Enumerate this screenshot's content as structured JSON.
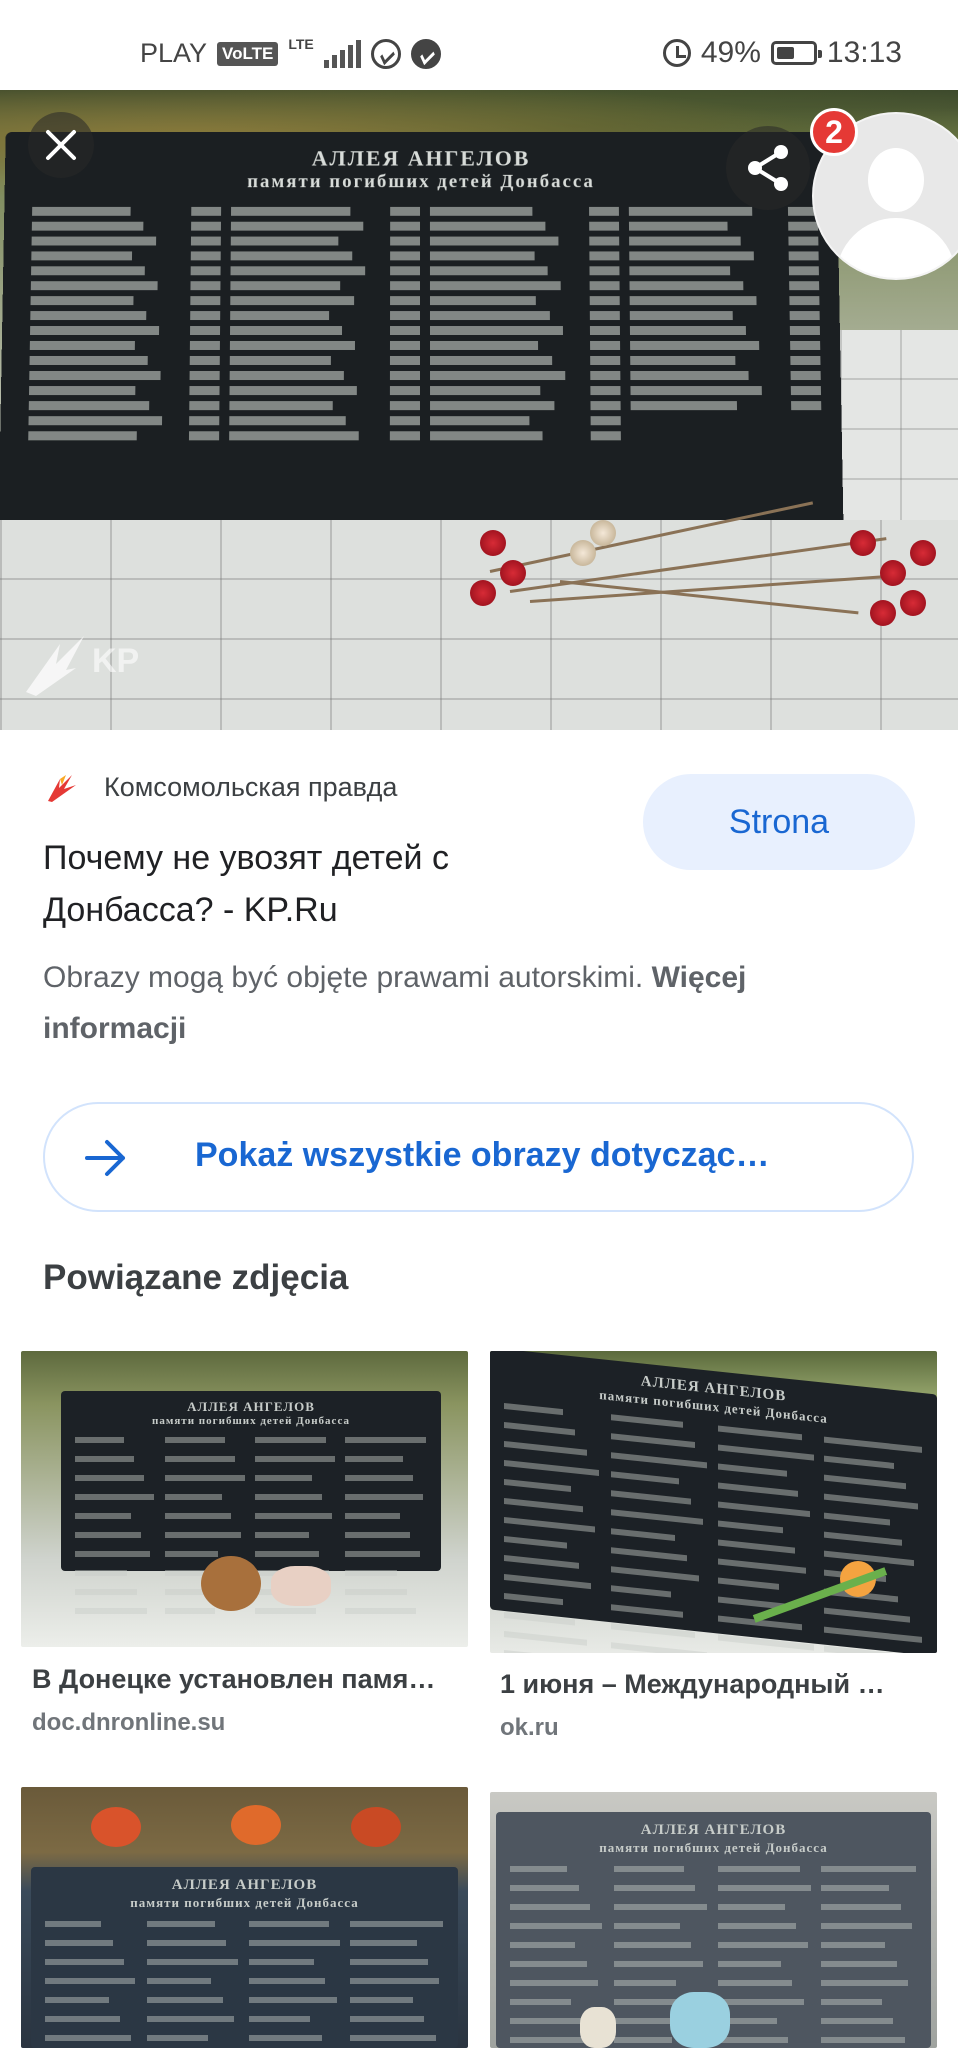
{
  "status_bar": {
    "carrier": "PLAY",
    "volte": "VoLTE",
    "network": "LTE",
    "battery": "49%",
    "battery_level": 0.49,
    "time": "13:13",
    "icons": [
      "messenger-icon",
      "messenger-icon",
      "alarm-icon",
      "battery-icon",
      "signal-icon"
    ]
  },
  "viewer": {
    "close_icon": "close-icon",
    "share_icon": "share-icon",
    "notification_count": "2",
    "image_plaque_title_1": "АЛЛЕЯ АНГЕЛОВ",
    "image_plaque_title_2": "памяти погибших детей Донбасса"
  },
  "result": {
    "source_name": "Комсомольская правда",
    "title": "Почему не увозят детей с Донбасса? - KP.Ru",
    "visit_label": "Strona",
    "copyright_text": "Obrazy mogą być objęte prawami autorskimi.",
    "copyright_link": "Więcej informacji",
    "all_images_label": "Pokaż wszystkie obrazy dotycząc…"
  },
  "related": {
    "heading": "Powiązane zdjęcia",
    "items": [
      {
        "title": "В Донецке установлен памя…",
        "source": "doc.dnronline.su"
      },
      {
        "title": "1 июня – Международный …",
        "source": "ok.ru"
      },
      {
        "title": "",
        "source": ""
      },
      {
        "title": "",
        "source": ""
      }
    ]
  },
  "colors": {
    "accent": "#1967d2",
    "accent_bg": "#e8f0fe",
    "badge": "#e53935"
  }
}
